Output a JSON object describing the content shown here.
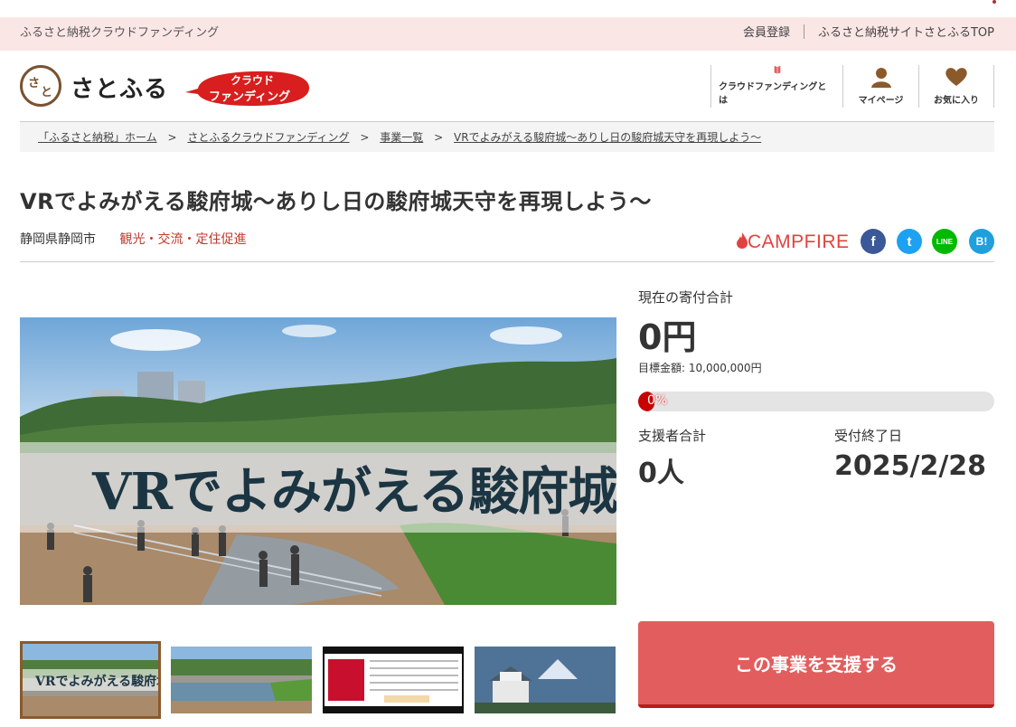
{
  "topbar": {
    "site_label": "ふるさと納税クラウドファンディング",
    "member_register": "会員登録",
    "top_link": "ふるさと納税サイトさとふるTOP"
  },
  "logo": {
    "glyph_top": "さ",
    "glyph_bottom": "と",
    "text": "さとふる",
    "badge_line1": "クラウド",
    "badge_line2": "ファンディング"
  },
  "nav": [
    {
      "label": "クラウドファンディングとは",
      "icon": "book-icon"
    },
    {
      "label": "マイページ",
      "icon": "user-icon"
    },
    {
      "label": "お気に入り",
      "icon": "heart-icon"
    }
  ],
  "breadcrumb": [
    "「ふるさと納税」ホーム",
    "さとふるクラウドファンディング",
    "事業一覧",
    "VRでよみがえる駿府城～ありし日の駿府城天守を再現しよう～"
  ],
  "project": {
    "title": "VRでよみがえる駿府城～ありし日の駿府城天守を再現しよう～",
    "location": "静岡県静岡市",
    "category": "観光・交流・定住促進",
    "partner": "CAMPFIRE",
    "hero_text": "VRでよみがえる駿府城"
  },
  "share": {
    "facebook": "f",
    "twitter": "t",
    "line": "LINE",
    "hatena": "B!"
  },
  "stats": {
    "current_label": "現在の寄付合計",
    "current_amount": "0円",
    "goal": "目標金額: 10,000,000円",
    "progress_text": "0%",
    "progress_fraction": 0,
    "supporters_label": "支援者合計",
    "supporters": "0人",
    "deadline_label": "受付終了日",
    "deadline": "2025/2/28"
  },
  "cta": {
    "label": "この事業を支援する"
  },
  "colors": {
    "accent": "#e25e5e",
    "progress": "#c80000",
    "category": "#c0392b",
    "topbar_bg": "#fbe6e6",
    "logo_brown": "#7a5230"
  }
}
